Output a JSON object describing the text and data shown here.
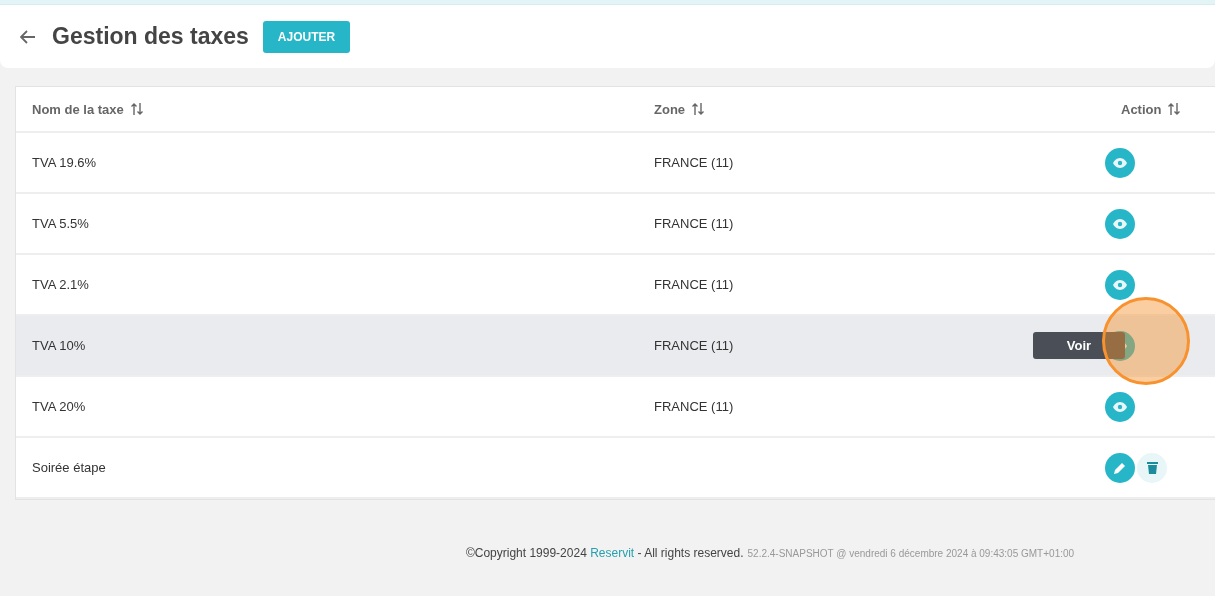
{
  "header": {
    "title": "Gestion des taxes",
    "add_button": "AJOUTER"
  },
  "table": {
    "columns": [
      "Nom de la taxe",
      "Zone",
      "Action"
    ],
    "rows": [
      {
        "name": "TVA 19.6%",
        "zone": "FRANCE (11)",
        "hovered": false,
        "actions": [
          {
            "kind": "view"
          }
        ]
      },
      {
        "name": "TVA 5.5%",
        "zone": "FRANCE (11)",
        "hovered": false,
        "actions": [
          {
            "kind": "view"
          }
        ]
      },
      {
        "name": "TVA 2.1%",
        "zone": "FRANCE (11)",
        "hovered": false,
        "actions": [
          {
            "kind": "view"
          }
        ]
      },
      {
        "name": "TVA 10%",
        "zone": "FRANCE (11)",
        "hovered": true,
        "tooltip": "Voir",
        "actions": [
          {
            "kind": "view"
          }
        ]
      },
      {
        "name": "TVA 20%",
        "zone": "FRANCE (11)",
        "hovered": false,
        "actions": [
          {
            "kind": "view"
          }
        ]
      },
      {
        "name": "Soirée étape",
        "hovered": false,
        "actions": [
          {
            "kind": "edit"
          },
          {
            "kind": "delete"
          }
        ]
      }
    ]
  },
  "footer": {
    "copyright": "©Copyright 1999-2024 ",
    "link": "Reservit",
    "rights": " - All rights reserved.",
    "version": "52.2.4-SNAPSHOT @ vendredi 6 décembre 2024 à 09:43:05 GMT+01:00"
  }
}
